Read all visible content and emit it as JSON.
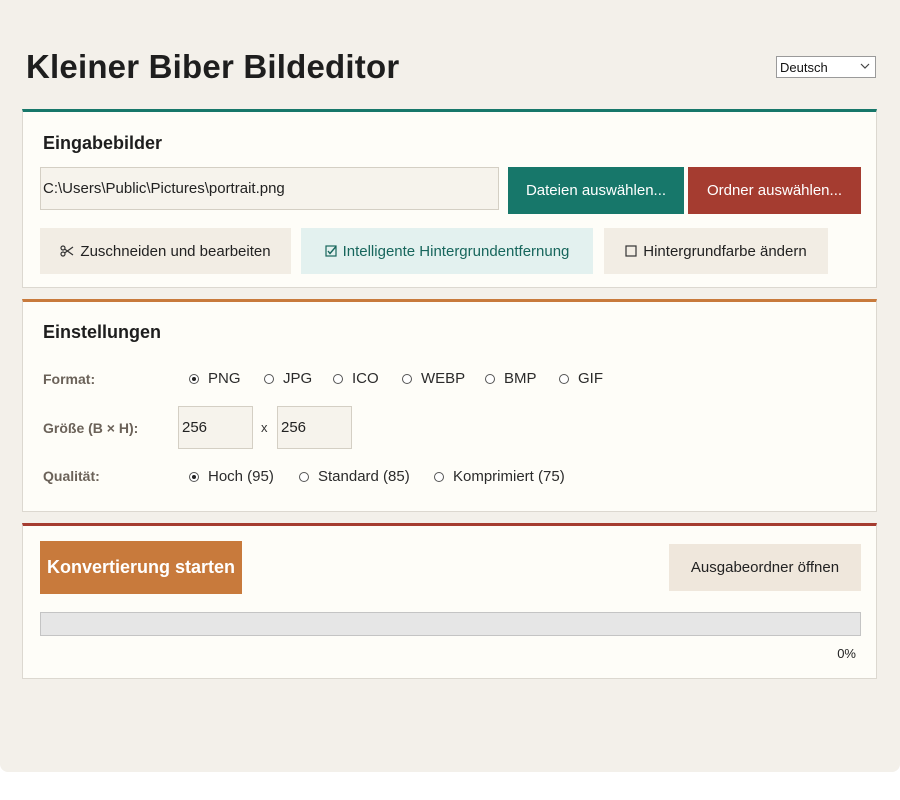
{
  "app": {
    "title": "Kleiner Biber Bildeditor"
  },
  "language": {
    "selected": "Deutsch"
  },
  "input_panel": {
    "heading": "Eingabebilder",
    "path_value": "C:\\Users\\Public\\Pictures\\portrait.png",
    "select_files_label": "Dateien auswählen...",
    "select_folder_label": "Ordner auswählen...",
    "crop_edit_label": "Zuschneiden und bearbeiten",
    "smart_bg_removal_label": "Intelligente Hintergrundentfernung",
    "change_bg_color_label": "Hintergrundfarbe ändern"
  },
  "settings_panel": {
    "heading": "Einstellungen",
    "format_label": "Format:",
    "formats": [
      "PNG",
      "JPG",
      "ICO",
      "WEBP",
      "BMP",
      "GIF"
    ],
    "format_selected": "PNG",
    "size_label": "Größe (B × H):",
    "width_value": "256",
    "height_value": "256",
    "size_separator": "x",
    "quality_label": "Qualität:",
    "qualities": [
      "Hoch (95)",
      "Standard (85)",
      "Komprimiert (75)"
    ],
    "quality_selected": "Hoch (95)"
  },
  "action_panel": {
    "start_label": "Konvertierung starten",
    "open_output_label": "Ausgabeordner öffnen",
    "progress_fraction": 0,
    "progress_text": "0%"
  },
  "colors": {
    "teal": "#17776a",
    "red": "#a53c30",
    "orange": "#c87a3c",
    "window_bg": "#f3f0ea"
  },
  "icons": {
    "crop": "scissors-icon",
    "smart_bg": "checkbox-checked-icon",
    "bg_color": "checkbox-empty-icon",
    "language_dropdown": "chevron-down-icon"
  }
}
